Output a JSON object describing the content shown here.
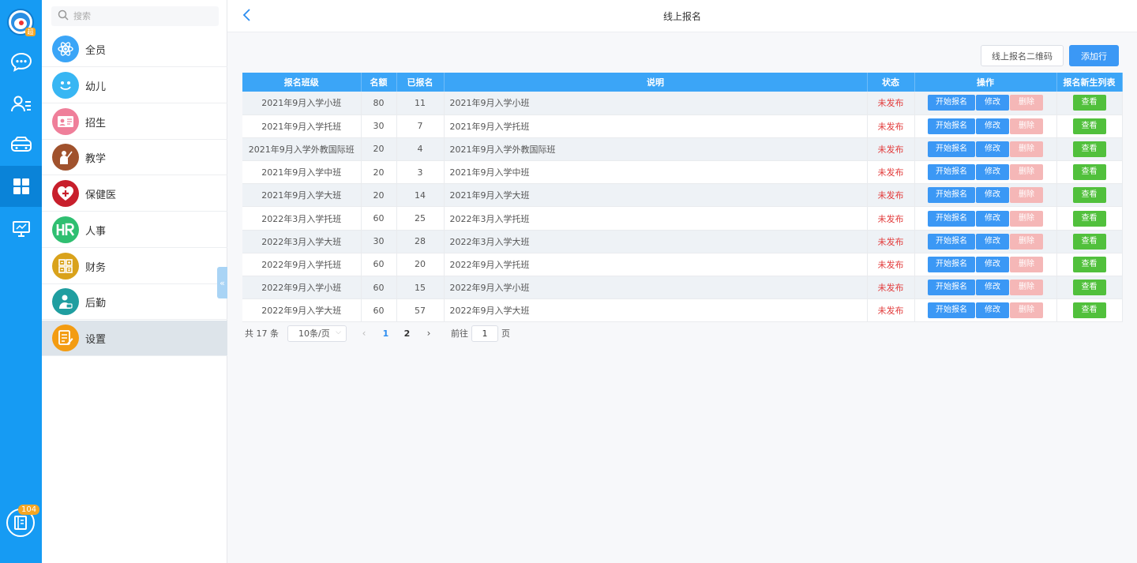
{
  "rail": {
    "avatar_badge": "超",
    "icons": [
      "chat-icon",
      "contacts-icon",
      "bus-icon",
      "apps-grid-icon",
      "monitor-icon"
    ],
    "active_index": 3,
    "bottom_badge": "104"
  },
  "sidebar": {
    "search_placeholder": "搜索",
    "items": [
      {
        "label": "全员",
        "icon": "atom-icon",
        "color": "#3ba5f7"
      },
      {
        "label": "幼儿",
        "icon": "smiley-icon",
        "color": "#38b6f3"
      },
      {
        "label": "招生",
        "icon": "id-card-icon",
        "color": "#ef7f9a"
      },
      {
        "label": "教学",
        "icon": "teacher-icon",
        "color": "#a0522d"
      },
      {
        "label": "保健医",
        "icon": "heart-plus-icon",
        "color": "#c81f2c"
      },
      {
        "label": "人事",
        "icon": "hr-icon",
        "color": "#2fbf71"
      },
      {
        "label": "财务",
        "icon": "calculator-icon",
        "color": "#d9a21b"
      },
      {
        "label": "后勤",
        "icon": "staff-icon",
        "color": "#1f9ea0"
      },
      {
        "label": "设置",
        "icon": "settings-doc-icon",
        "color": "#f39c12"
      }
    ],
    "active_index": 8
  },
  "header": {
    "title": "线上报名",
    "back": "‹"
  },
  "toolbar": {
    "qr_label": "线上报名二维码",
    "add_label": "添加行"
  },
  "table": {
    "columns": [
      "报名班级",
      "名额",
      "已报名",
      "说明",
      "状态",
      "操作",
      "报名新生列表"
    ],
    "actions": {
      "start": "开始报名",
      "edit": "修改",
      "delete": "删除",
      "view": "查看"
    },
    "rows": [
      {
        "cls": "2021年9月入学小班",
        "quota": "80",
        "enrolled": "11",
        "desc": "2021年9月入学小班",
        "status": "未发布"
      },
      {
        "cls": "2021年9月入学托班",
        "quota": "30",
        "enrolled": "7",
        "desc": "2021年9月入学托班",
        "status": "未发布"
      },
      {
        "cls": "2021年9月入学外教国际班",
        "quota": "20",
        "enrolled": "4",
        "desc": "2021年9月入学外教国际班",
        "status": "未发布"
      },
      {
        "cls": "2021年9月入学中班",
        "quota": "20",
        "enrolled": "3",
        "desc": "2021年9月入学中班",
        "status": "未发布"
      },
      {
        "cls": "2021年9月入学大班",
        "quota": "20",
        "enrolled": "14",
        "desc": "2021年9月入学大班",
        "status": "未发布"
      },
      {
        "cls": "2022年3月入学托班",
        "quota": "60",
        "enrolled": "25",
        "desc": "2022年3月入学托班",
        "status": "未发布"
      },
      {
        "cls": "2022年3月入学大班",
        "quota": "30",
        "enrolled": "28",
        "desc": "2022年3月入学大班",
        "status": "未发布"
      },
      {
        "cls": "2022年9月入学托班",
        "quota": "60",
        "enrolled": "20",
        "desc": "2022年9月入学托班",
        "status": "未发布"
      },
      {
        "cls": "2022年9月入学小班",
        "quota": "60",
        "enrolled": "15",
        "desc": "2022年9月入学小班",
        "status": "未发布"
      },
      {
        "cls": "2022年9月入学大班",
        "quota": "60",
        "enrolled": "57",
        "desc": "2022年9月入学大班",
        "status": "未发布"
      }
    ]
  },
  "pagination": {
    "total": "共 17 条",
    "page_size": "10条/页",
    "pages": [
      "1",
      "2"
    ],
    "current": "1",
    "goto_prefix": "前往",
    "goto_value": "1",
    "goto_suffix": "页"
  }
}
